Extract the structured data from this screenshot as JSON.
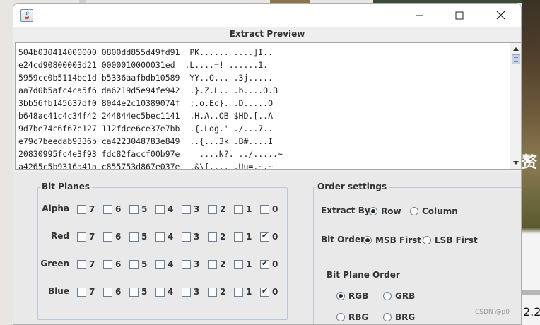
{
  "window": {
    "title": "",
    "preview_title": "Extract Preview"
  },
  "hex_preview": {
    "lines": [
      "504b030414000000 0800dd855d49fd91  PK...... ....]I..",
      "e24cd90800003d21 0000010000031ed  .L....=! ......1.",
      "5959cc0b5114be1d b5336aafbdb10589  YY..Q... .3j.....",
      "aa7d0b5afc4ca5f6 da6219d5e94fe942  .}.Z.L.. .b....O.B",
      "3bb56fb145637df0 8044e2c10389074f  ;.o.Ec}. .D.....O",
      "b648ac41c4c34f42 244844ec5bec1141  .H.A..OB $HD.[..A",
      "9d7be74c6f67e127 112fdce6ce37e7bb  .{.Log.' ./...7..",
      "e79c7beedab9336b ca4223048783e849  ..{...3k .B#....I",
      "20830995fc4e3f93 fdc82faccf00b97e    ....N?. ../.....~",
      "a4265c5b9316a41a c855753d867e037e  .&\\[.... .Uu=.~.~"
    ]
  },
  "bit_planes": {
    "title": "Bit Planes",
    "bits": [
      "7",
      "6",
      "5",
      "4",
      "3",
      "2",
      "1",
      "0"
    ],
    "rows": [
      {
        "label": "Alpha",
        "checked": [
          false,
          false,
          false,
          false,
          false,
          false,
          false,
          false
        ]
      },
      {
        "label": "Red",
        "checked": [
          false,
          false,
          false,
          false,
          false,
          false,
          false,
          true
        ]
      },
      {
        "label": "Green",
        "checked": [
          false,
          false,
          false,
          false,
          false,
          false,
          false,
          true
        ]
      },
      {
        "label": "Blue",
        "checked": [
          false,
          false,
          false,
          false,
          false,
          false,
          false,
          true
        ]
      }
    ]
  },
  "order_settings": {
    "title": "Order settings",
    "extract_by": {
      "label": "Extract By",
      "options": [
        "Row",
        "Column"
      ],
      "selected": "Row"
    },
    "bit_order": {
      "label": "Bit Order",
      "options": [
        "MSB First",
        "LSB First"
      ],
      "selected": "MSB First"
    },
    "bit_plane_order": {
      "label": "Bit Plane Order",
      "options": [
        "RGB",
        "GRB",
        "RBG",
        "BRG"
      ],
      "selected": "RGB"
    }
  },
  "background": {
    "side_char": "赘",
    "side_version": "2.2",
    "watermark": "CSDN @p0"
  }
}
